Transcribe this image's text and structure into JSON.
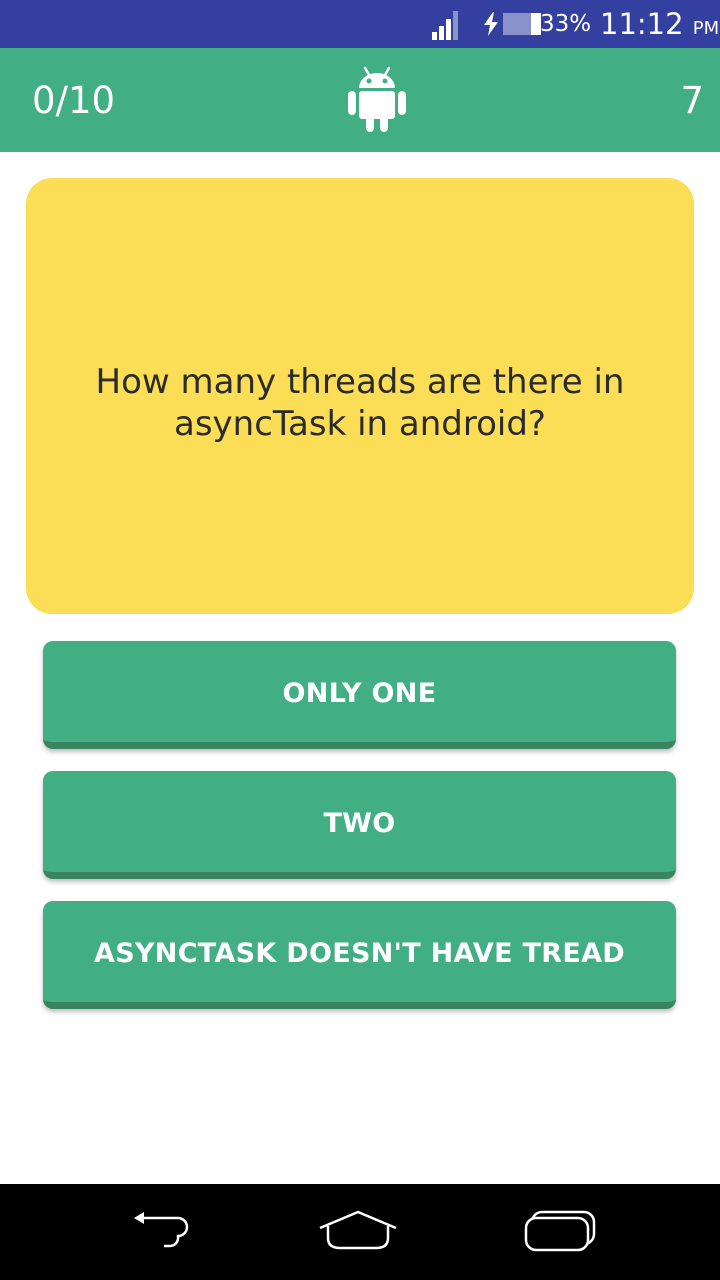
{
  "status_bar": {
    "battery_percent": "33%",
    "time": "11:12",
    "ampm": "PM",
    "icons": [
      "signal-icon",
      "charging-icon",
      "battery-icon"
    ]
  },
  "app_bar": {
    "score": "0/10",
    "timer": "7",
    "logo_icon": "android-logo-icon"
  },
  "question": {
    "text": "How many threads are there in asyncTask in android?"
  },
  "answers": [
    {
      "label": "ONLY ONE"
    },
    {
      "label": "TWO"
    },
    {
      "label": "ASYNCTASK DOESN'T HAVE TREAD"
    }
  ],
  "nav_bar": {
    "icons": [
      "back-icon",
      "home-icon",
      "recent-apps-icon"
    ]
  },
  "colors": {
    "status_bar": "#3340a0",
    "app_bar": "#42ae84",
    "question_card": "#fcde56",
    "answer_button": "#42ae84",
    "answer_button_shadow": "#37845f",
    "nav_bar": "#000000"
  }
}
